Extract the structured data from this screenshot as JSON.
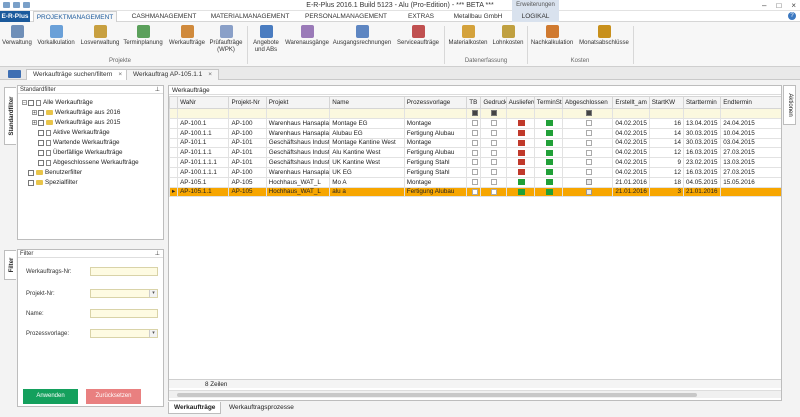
{
  "window": {
    "title": "E-R-Plus 2016.1 Build 5123 -  Alu (Pro-Edition) - *** BETA ***",
    "extension_tab": "Erweiterungen"
  },
  "ribbon_tabs": [
    {
      "label": "E-R-Plus",
      "kind": "brand"
    },
    {
      "label": "PROJEKTMANAGEMENT",
      "kind": "active"
    },
    {
      "label": "CASHMANAGEMENT",
      "kind": "normal"
    },
    {
      "label": "MATERIALMANAGEMENT",
      "kind": "normal"
    },
    {
      "label": "PERSONALMANAGEMENT",
      "kind": "normal"
    },
    {
      "label": "EXTRAS",
      "kind": "normal"
    },
    {
      "label": "Metallbau GmbH",
      "kind": "normal"
    },
    {
      "label": "LOGIKAL",
      "kind": "highlight"
    }
  ],
  "ribbon": {
    "groups": [
      {
        "label": "Projekte"
      },
      {
        "label": ""
      },
      {
        "label": "Datenerfassung"
      },
      {
        "label": "Kosten"
      }
    ],
    "buttons": [
      {
        "label": "Verwaltung",
        "icon": "folder-gear-icon",
        "color": "#6f8fb8"
      },
      {
        "label": "Vorkalkulation",
        "icon": "calculator-icon",
        "color": "#6aa0d8"
      },
      {
        "label": "Losverwaltung",
        "icon": "list-icon",
        "color": "#c8a040"
      },
      {
        "label": "Terminplanung",
        "icon": "gantt-icon",
        "color": "#5ba05b"
      },
      {
        "label": "Werkaufträge",
        "icon": "work-orders-icon",
        "color": "#d08a3c"
      },
      {
        "label": "Prüfaufträge (WPK)",
        "icon": "inspection-icon",
        "color": "#8aa0c8"
      },
      {
        "label": "Angebote und ABs",
        "icon": "offer-icon",
        "color": "#4a7cc0"
      },
      {
        "label": "Warenausgänge",
        "icon": "goods-out-icon",
        "color": "#9a7ab8"
      },
      {
        "label": "Ausgangsrechnungen",
        "icon": "invoice-icon",
        "color": "#5e86c2"
      },
      {
        "label": "Serviceaufträge",
        "icon": "service-icon",
        "color": "#c05050"
      },
      {
        "label": "Materialkosten",
        "icon": "material-cost-icon",
        "color": "#d4a23c"
      },
      {
        "label": "Lohnkosten",
        "icon": "labor-cost-icon",
        "color": "#c0a040"
      },
      {
        "label": "Nachkalkulation",
        "icon": "post-calc-icon",
        "color": "#d07a30"
      },
      {
        "label": "Monatsabschlüsse",
        "icon": "month-close-icon",
        "color": "#c8901c"
      }
    ]
  },
  "doc_tabs": [
    {
      "label": "Werkaufträge suchen/filtern",
      "close": "×",
      "active": true
    },
    {
      "label": "Werkauftrag AP-105.1.1",
      "close": "×",
      "active": false
    }
  ],
  "side_tabs": {
    "standardfilter": "Standardfilter",
    "filter": "Filter",
    "aktionen": "Aktionen"
  },
  "standardfilter": {
    "header": "Standardfilter",
    "tree": [
      {
        "label": "Alle Werkaufträge",
        "level": 0,
        "expander": "−",
        "icon": "doc-icon"
      },
      {
        "label": "Werkaufträge aus 2016",
        "level": 1,
        "expander": "+",
        "icon": "folder-icon"
      },
      {
        "label": "Werkaufträge aus 2015",
        "level": 1,
        "expander": "+",
        "icon": "folder-icon"
      },
      {
        "label": "Aktive Werkaufträge",
        "level": 1,
        "expander": "",
        "icon": "doc-icon"
      },
      {
        "label": "Wartende Werkaufträge",
        "level": 1,
        "expander": "",
        "icon": "doc-icon"
      },
      {
        "label": "Überfällige Werkaufträge",
        "level": 1,
        "expander": "",
        "icon": "doc-icon"
      },
      {
        "label": "Abgeschlossene Werkaufträge",
        "level": 1,
        "expander": "",
        "icon": "doc-icon"
      },
      {
        "label": "Benutzerfilter",
        "level": 0,
        "expander": "",
        "icon": "folder-icon"
      },
      {
        "label": "Spezialfilter",
        "level": 0,
        "expander": "",
        "icon": "folder-icon"
      }
    ]
  },
  "filter": {
    "header": "Filter",
    "fields": [
      {
        "label": "Werkauftrags-Nr:",
        "value": "",
        "dropdown": false
      },
      {
        "label": "Projekt-Nr:",
        "value": "",
        "dropdown": true
      },
      {
        "label": "Name:",
        "value": "",
        "dropdown": false
      },
      {
        "label": "Prozessvorlage:",
        "value": "",
        "dropdown": true
      }
    ],
    "apply": "Anwenden",
    "reset": "Zurücksetzen"
  },
  "grid": {
    "title": "Werkaufträge",
    "columns": [
      "WaNr",
      "Projekt-Nr",
      "Projekt",
      "Name",
      "Prozessvorlage",
      "TB",
      "Gedruckt",
      "Auslieferung",
      "TerminStatus",
      "Abgeschlossen",
      "Erstellt_am",
      "StartKW",
      "Starttermin",
      "Endtermin"
    ],
    "rows": [
      {
        "wanr": "AP-100.1",
        "projekt_nr": "AP-100",
        "projekt": "Warenhaus Hansaplatz",
        "name": "Montage EG",
        "prozess": "Montage",
        "tb": false,
        "gedruckt": false,
        "auslieferung": "#c0392b",
        "terminstatus": "#21a038",
        "abgeschlossen": false,
        "erstellt": "04.02.2015",
        "startkw": "16",
        "start": "13.04.2015",
        "end": "24.04.2015",
        "selected": false
      },
      {
        "wanr": "AP-100.1.1",
        "projekt_nr": "AP-100",
        "projekt": "Warenhaus Hansaplatz",
        "name": "Alubau EG",
        "prozess": "Fertigung Alubau",
        "tb": false,
        "gedruckt": false,
        "auslieferung": "#c0392b",
        "terminstatus": "#21a038",
        "abgeschlossen": false,
        "erstellt": "04.02.2015",
        "startkw": "14",
        "start": "30.03.2015",
        "end": "10.04.2015",
        "selected": false
      },
      {
        "wanr": "AP-101.1",
        "projekt_nr": "AP-101",
        "projekt": "Geschäftshaus Industriestr.",
        "name": "Montage Kantine West",
        "prozess": "Montage",
        "tb": false,
        "gedruckt": false,
        "auslieferung": "#c0392b",
        "terminstatus": "#21a038",
        "abgeschlossen": false,
        "erstellt": "04.02.2015",
        "startkw": "14",
        "start": "30.03.2015",
        "end": "03.04.2015",
        "selected": false
      },
      {
        "wanr": "AP-101.1.1",
        "projekt_nr": "AP-101",
        "projekt": "Geschäftshaus Industriestr.",
        "name": "Alu Kantine West",
        "prozess": "Fertigung Alubau",
        "tb": false,
        "gedruckt": false,
        "auslieferung": "#c0392b",
        "terminstatus": "#21a038",
        "abgeschlossen": false,
        "erstellt": "04.02.2015",
        "startkw": "12",
        "start": "16.03.2015",
        "end": "27.03.2015",
        "selected": false
      },
      {
        "wanr": "AP-101.1.1.1",
        "projekt_nr": "AP-101",
        "projekt": "Geschäftshaus Industriestr.",
        "name": "UK Kantine West",
        "prozess": "Fertigung Stahl",
        "tb": false,
        "gedruckt": false,
        "auslieferung": "#c0392b",
        "terminstatus": "#21a038",
        "abgeschlossen": false,
        "erstellt": "04.02.2015",
        "startkw": "9",
        "start": "23.02.2015",
        "end": "13.03.2015",
        "selected": false
      },
      {
        "wanr": "AP-100.1.1.1",
        "projekt_nr": "AP-100",
        "projekt": "Warenhaus Hansaplatz",
        "name": "UK EG",
        "prozess": "Fertigung Stahl",
        "tb": false,
        "gedruckt": false,
        "auslieferung": "#c0392b",
        "terminstatus": "#21a038",
        "abgeschlossen": false,
        "erstellt": "04.02.2015",
        "startkw": "12",
        "start": "16.03.2015",
        "end": "27.03.2015",
        "selected": false
      },
      {
        "wanr": "AP-105.1",
        "projekt_nr": "AP-105",
        "projekt": "Hochhaus_WAT_L",
        "name": "Mo A",
        "prozess": "Montage",
        "tb": false,
        "gedruckt": false,
        "auslieferung": "#21a038",
        "terminstatus": "#21a038",
        "abgeschlossen": true,
        "erstellt": "21.01.2016",
        "startkw": "18",
        "start": "04.05.2015",
        "end": "15.05.2016",
        "selected": false
      },
      {
        "wanr": "AP-105.1.1",
        "projekt_nr": "AP-105",
        "projekt": "Hochhaus_WAT_L",
        "name": "alu a",
        "prozess": "Fertigung Alubau",
        "tb": false,
        "gedruckt": false,
        "auslieferung": "#21a038",
        "terminstatus": "#21a038",
        "abgeschlossen": true,
        "erstellt": "21.01.2016",
        "startkw": "3",
        "start": "21.01.2016",
        "end": "",
        "selected": true
      }
    ],
    "footer_count": "8 Zeilen"
  },
  "bottom_tabs": [
    {
      "label": "Werkaufträge",
      "active": true
    },
    {
      "label": "Werkauftragsprozesse",
      "active": false
    }
  ]
}
